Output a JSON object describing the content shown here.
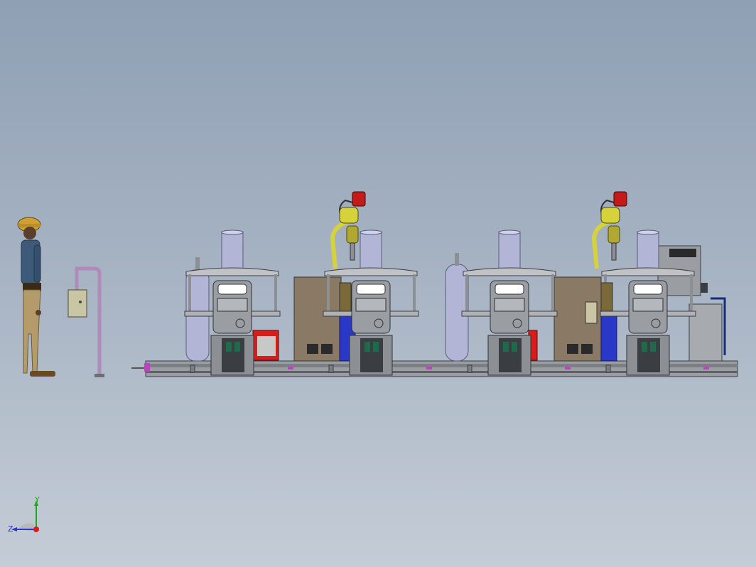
{
  "viewport": {
    "background_top": "#8fa0b4",
    "background_bottom": "#c4ccd6"
  },
  "triad": {
    "y_label": "Y",
    "z_label": "Z",
    "colors": {
      "y": "#1fa81f",
      "z": "#2b39c8",
      "x": "#e01a1a"
    }
  },
  "model": {
    "station_count": 4,
    "robot_count": 2,
    "colors": {
      "frame": "#8c8f94",
      "panel": "#6d6f74",
      "gas_cylinder": "#b3b5d6",
      "cabinet": "#8a7964",
      "robot": "#d8d23a",
      "robot_head": "#c41a1a",
      "accent_blue": "#2a38c8",
      "rail_magenta": "#c040c0",
      "red_box": "#d81c1c",
      "helmet": "#d0a030",
      "shirt": "#3e5a7a",
      "pants": "#b39b6a"
    }
  }
}
